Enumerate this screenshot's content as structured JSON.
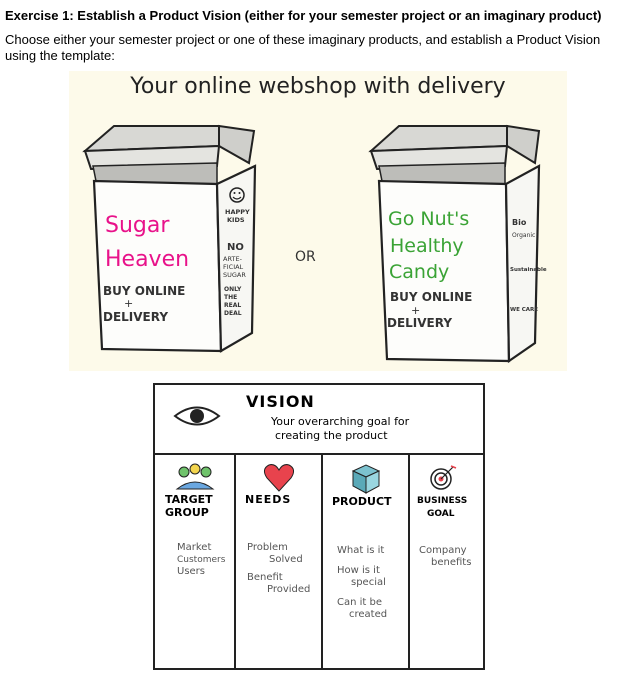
{
  "doc": {
    "heading": "Exercise 1: Establish a Product Vision (either for your semester project or an imaginary product)",
    "paragraph": "Choose either your semester project or one of these imaginary products, and establish a Product Vision using the template:"
  },
  "illustration": {
    "title": "Your online webshop with delivery",
    "or_label": "OR",
    "box_left": {
      "name_line1": "Sugar",
      "name_line2": "Heaven",
      "buy_line": "BUY ONLINE",
      "plus": "+",
      "delivery": "DELIVERY",
      "side_lines": [
        "HAPPY",
        "KIDS",
        "NO",
        "ARTE-",
        "FICIAL",
        "SUGAR",
        "ONLY",
        "THE",
        "REAL",
        "DEAL"
      ]
    },
    "box_right": {
      "name_line1": "Go Nut's",
      "name_line2": "Healthy",
      "name_line3": "Candy",
      "buy_line": "BUY ONLINE",
      "plus": "+",
      "delivery": "DELIVERY",
      "side_lines": [
        "Bio",
        "Organic",
        "Sustainable",
        "WE CARE"
      ]
    },
    "colors": {
      "left_name": "#e8128a",
      "right_name": "#3aa335",
      "background": "#fdfaea"
    }
  },
  "canvas": {
    "vision_title": "VISION",
    "vision_sub_line1": "Your overarching goal for",
    "vision_sub_line2": "creating the product",
    "columns": [
      {
        "title_line1": "TARGET",
        "title_line2": "GROUP",
        "items": [
          "Market",
          "Customers",
          "Users"
        ],
        "icon": "people-icon"
      },
      {
        "title_line1": "NEEDS",
        "title_line2": "",
        "items": [
          "Problem",
          "Solved",
          "Benefit",
          "Provided"
        ],
        "icon": "heart-icon"
      },
      {
        "title_line1": "PRODUCT",
        "title_line2": "",
        "items": [
          "What is it",
          "How is it",
          "special",
          "Can it be",
          "created"
        ],
        "icon": "box-icon"
      },
      {
        "title_line1": "BUSINESS",
        "title_line2": "GOAL",
        "items": [
          "Company",
          "benefits"
        ],
        "icon": "target-icon"
      }
    ]
  }
}
